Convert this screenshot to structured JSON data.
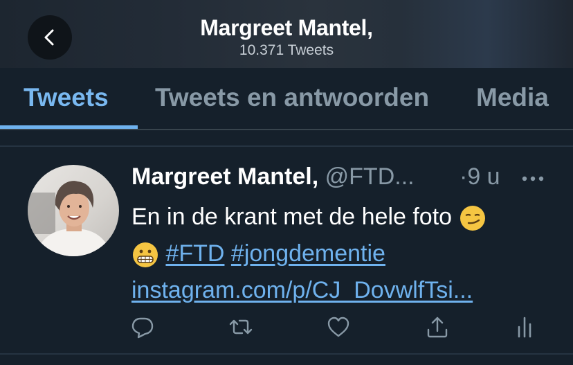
{
  "header": {
    "title": "Margreet Mantel,",
    "subtitle": "10.371 Tweets"
  },
  "tabs": [
    {
      "label": "Tweets",
      "active": true
    },
    {
      "label": "Tweets en antwoorden",
      "active": false
    },
    {
      "label": "Media",
      "active": false
    }
  ],
  "tweet": {
    "name": "Margreet Mantel,",
    "handle": "@FTD...",
    "time": "·9 u",
    "text_line1": "En in de krant met de hele foto",
    "hashtag1": "#FTD",
    "hashtag2": "#jongdementie",
    "link": "instagram.com/p/CJ_DovwlfTsi...",
    "emoji1": "smirking-face",
    "emoji2": "grimacing-face"
  },
  "actions": [
    "reply-icon",
    "retweet-icon",
    "like-icon",
    "share-icon",
    "analytics-icon"
  ],
  "colors": {
    "background": "#15202b",
    "accent": "#6fb2ee",
    "muted": "#8899a6"
  }
}
